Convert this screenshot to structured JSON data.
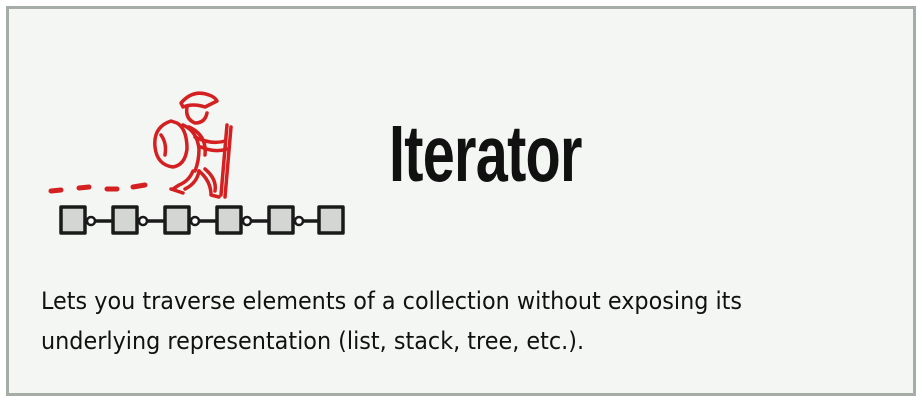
{
  "card": {
    "title": "Iterator",
    "description": "Lets you traverse elements of a collection without exposing its underlying representation (list, stack, tree, etc.)."
  },
  "illustration": {
    "icon": "hiker-on-chain-icon",
    "colors": {
      "accent": "#d42020",
      "chain": "#1a1a1a",
      "block_fill": "#d3d6d3"
    }
  }
}
